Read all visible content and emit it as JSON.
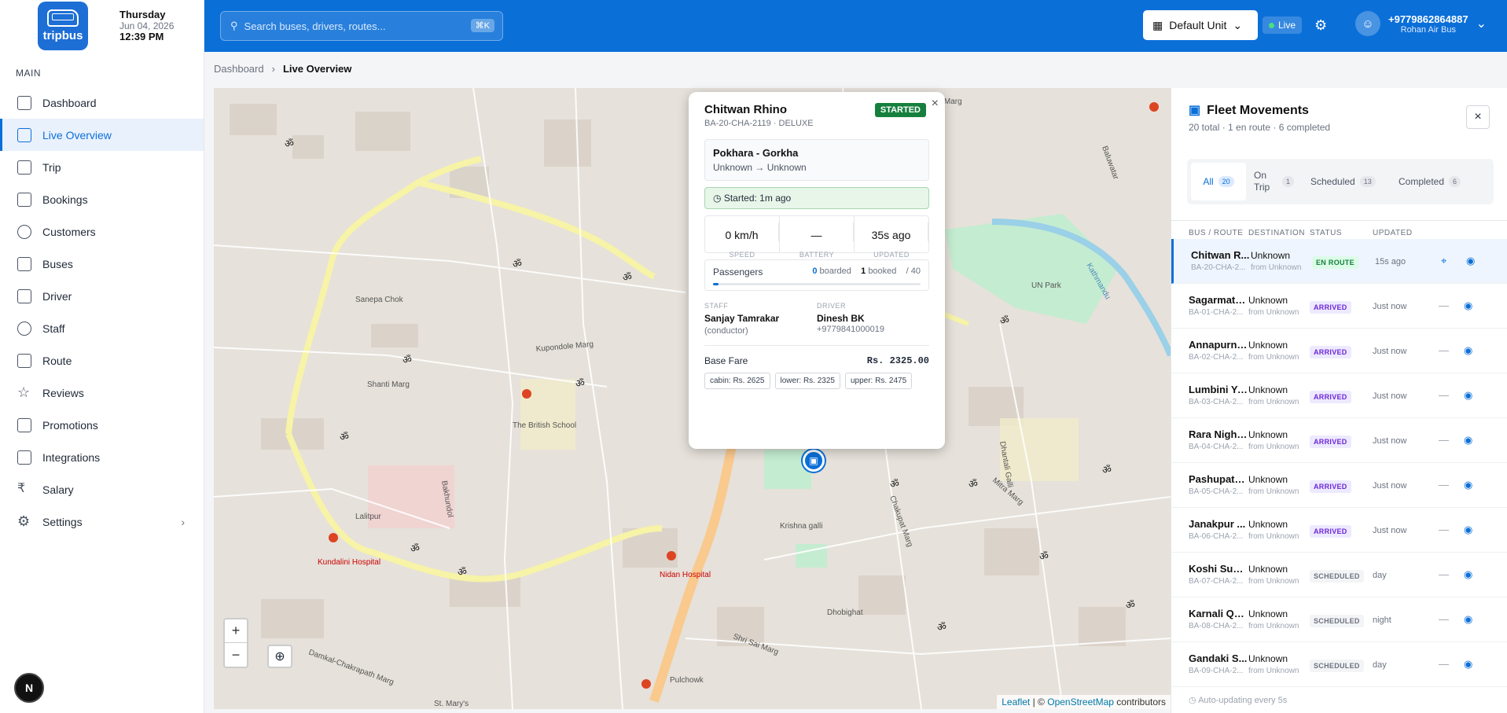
{
  "header": {
    "brand": "tripbus",
    "date_day": "Thursday",
    "date": "Jun 04, 2026",
    "time": "12:39 PM",
    "search_placeholder": "Search buses, drivers, routes...",
    "search_shortcut": "⌘K",
    "unit": "Default Unit",
    "live": "Live",
    "user_phone": "+9779862864887",
    "user_company": "Rohan Air Bus"
  },
  "sidebar": {
    "section": "MAIN",
    "items": [
      {
        "label": "Dashboard",
        "icon": "grid-icon"
      },
      {
        "label": "Live Overview",
        "icon": "map-icon"
      },
      {
        "label": "Trip",
        "icon": "truck-icon"
      },
      {
        "label": "Bookings",
        "icon": "book-icon"
      },
      {
        "label": "Customers",
        "icon": "user-icon"
      },
      {
        "label": "Buses",
        "icon": "bus-icon"
      },
      {
        "label": "Driver",
        "icon": "id-card-icon"
      },
      {
        "label": "Staff",
        "icon": "users-icon"
      },
      {
        "label": "Route",
        "icon": "route-icon"
      },
      {
        "label": "Reviews",
        "icon": "star-icon"
      },
      {
        "label": "Promotions",
        "icon": "megaphone-icon"
      },
      {
        "label": "Integrations",
        "icon": "plug-icon"
      },
      {
        "label": "Salary",
        "icon": "rupee-icon"
      },
      {
        "label": "Settings",
        "icon": "gear-icon"
      }
    ],
    "avatar": "N"
  },
  "breadcrumb": {
    "root": "Dashboard",
    "current": "Live Overview"
  },
  "map": {
    "zoom_in": "+",
    "zoom_out": "−",
    "attribution_leaflet": "Leaflet",
    "attribution_sep": "| ©",
    "attribution_osm": "OpenStreetMap",
    "attribution_tail": "contributors",
    "labels": [
      "Sanepa Chok",
      "The British School",
      "Kupondole Marg",
      "UN Park",
      "Lalitpur",
      "Kundalini Hospital",
      "Nidan Hospital",
      "Pulchowk",
      "Krishna galli",
      "St. Mary's",
      "Shanti Marg",
      "Dhobighat",
      "Kathmandu",
      "Chakupat Marg",
      "Mitra Marg",
      "Bakhundol",
      "Damkal-Chakrapath Marg",
      "Shri Sai Marg",
      "Surya Marg",
      "Baluwatar",
      "Dhantali Galli"
    ]
  },
  "popup": {
    "title": "Chitwan Rhino",
    "sub": "BA-20-CHA-2119 · DELUXE",
    "status": "STARTED",
    "route": "Pokhara - Gorkha",
    "route_sub": "Unknown → Unknown",
    "started": "Started: 1m ago",
    "speed": "0 km/h",
    "speed_label": "SPEED",
    "battery": "—",
    "battery_label": "BATTERY",
    "updated": "35s ago",
    "updated_label": "UPDATED",
    "passengers_label": "Passengers",
    "boarded_n": "0",
    "boarded_t": "boarded",
    "booked_n": "1",
    "booked_t": "booked",
    "capacity": "/ 40",
    "passenger_fill": 0.025,
    "staff_label": "STAFF",
    "staff_name": "Sanjay Tamrakar",
    "staff_role": "(conductor)",
    "driver_label": "DRIVER",
    "driver_name": "Dinesh BK",
    "driver_phone": "+9779841000019",
    "fare_label": "Base Fare",
    "fare": "Rs. 2325.00",
    "chips": [
      "cabin: Rs. 2625",
      "lower: Rs. 2325",
      "upper: Rs. 2475"
    ]
  },
  "fleet": {
    "title": "Fleet Movements",
    "subtitle": "20 total · 1 en route · 6 completed",
    "tabs": [
      {
        "label": "All",
        "count": "20"
      },
      {
        "label": "On Trip",
        "count": "1"
      },
      {
        "label": "Scheduled",
        "count": "13"
      },
      {
        "label": "Completed",
        "count": "6"
      }
    ],
    "columns": [
      "BUS / ROUTE",
      "DESTINATION",
      "STATUS",
      "UPDATED"
    ],
    "rows": [
      {
        "name": "Chitwan R...",
        "plate": "BA-20-CHA-2...",
        "dest": "Unknown",
        "from": "from Unknown",
        "status": "EN ROUTE",
        "updated": "15s ago"
      },
      {
        "name": "Sagarmath...",
        "plate": "BA-01-CHA-2...",
        "dest": "Unknown",
        "from": "from Unknown",
        "status": "ARRIVED",
        "updated": "Just now"
      },
      {
        "name": "Annapurna...",
        "plate": "BA-02-CHA-2...",
        "dest": "Unknown",
        "from": "from Unknown",
        "status": "ARRIVED",
        "updated": "Just now"
      },
      {
        "name": "Lumbini Ya...",
        "plate": "BA-03-CHA-2...",
        "dest": "Unknown",
        "from": "from Unknown",
        "status": "ARRIVED",
        "updated": "Just now"
      },
      {
        "name": "Rara Night...",
        "plate": "BA-04-CHA-2...",
        "dest": "Unknown",
        "from": "from Unknown",
        "status": "ARRIVED",
        "updated": "Just now"
      },
      {
        "name": "Pashupati ...",
        "plate": "BA-05-CHA-2...",
        "dest": "Unknown",
        "from": "from Unknown",
        "status": "ARRIVED",
        "updated": "Just now"
      },
      {
        "name": "Janakpur ...",
        "plate": "BA-06-CHA-2...",
        "dest": "Unknown",
        "from": "from Unknown",
        "status": "ARRIVED",
        "updated": "Just now"
      },
      {
        "name": "Koshi Super",
        "plate": "BA-07-CHA-2...",
        "dest": "Unknown",
        "from": "from Unknown",
        "status": "SCHEDULED",
        "updated": "day"
      },
      {
        "name": "Karnali Qu...",
        "plate": "BA-08-CHA-2...",
        "dest": "Unknown",
        "from": "from Unknown",
        "status": "SCHEDULED",
        "updated": "night"
      },
      {
        "name": "Gandaki S...",
        "plate": "BA-09-CHA-2...",
        "dest": "Unknown",
        "from": "from Unknown",
        "status": "SCHEDULED",
        "updated": "day"
      }
    ],
    "footer": "Auto-updating every 5s",
    "status_colors": {
      "EN ROUTE": "#15803d",
      "ARRIVED": "#6d28d9",
      "SCHEDULED": "#6b7280"
    }
  }
}
